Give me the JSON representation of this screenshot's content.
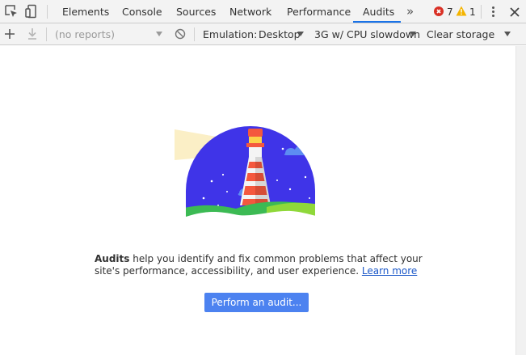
{
  "tabs": [
    {
      "label": "Elements",
      "active": false
    },
    {
      "label": "Console",
      "active": false
    },
    {
      "label": "Sources",
      "active": false
    },
    {
      "label": "Network",
      "active": false
    },
    {
      "label": "Performance",
      "active": false
    },
    {
      "label": "Audits",
      "active": true
    }
  ],
  "tabbar": {
    "overflow_glyph": "»",
    "error_count": "7",
    "warning_count": "1"
  },
  "toolbar": {
    "reports_select": "(no reports)",
    "emulation_label": "Emulation:",
    "device_select": "Desktop",
    "throttling_select": "3G w/ CPU slowdown",
    "storage_select": "Clear storage"
  },
  "main": {
    "intro_bold": "Audits",
    "intro_text": " help you identify and fix common problems that affect your site's performance, accessibility, and user experience. ",
    "learn_more": "Learn more",
    "audit_button": "Perform an audit..."
  },
  "colors": {
    "accent": "#1a73e8",
    "button": "#4c82f0",
    "error": "#d93025",
    "warning": "#f4b400",
    "illustration_sky": "#3f34e8"
  }
}
